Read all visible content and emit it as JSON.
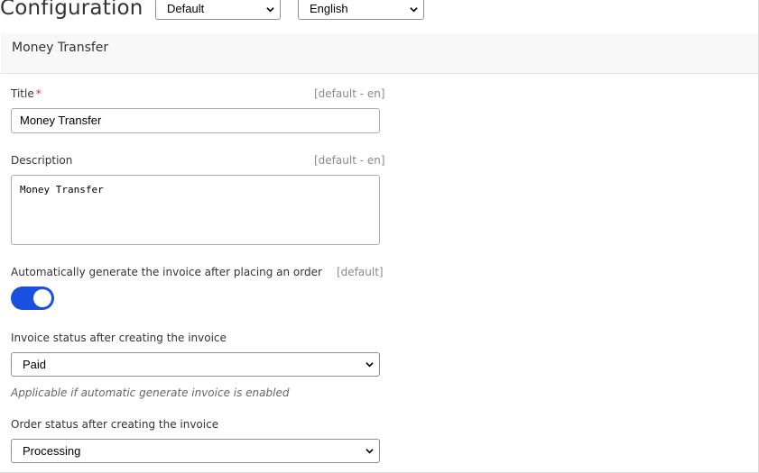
{
  "header": {
    "title": "Configuration",
    "scope_select": {
      "value": "Default"
    },
    "language_select": {
      "value": "English"
    }
  },
  "section": {
    "title": "Money Transfer"
  },
  "fields": {
    "title": {
      "label": "Title",
      "required_mark": "*",
      "scope": "[default - en]",
      "value": "Money Transfer"
    },
    "description": {
      "label": "Description",
      "scope": "[default - en]",
      "value": "Money Transfer"
    },
    "auto_invoice": {
      "label": "Automatically generate the invoice after placing an order",
      "scope": "[default]",
      "enabled": true
    },
    "invoice_status": {
      "label": "Invoice status after creating the invoice",
      "value": "Paid",
      "hint": "Applicable if automatic generate invoice is enabled"
    },
    "order_status": {
      "label": "Order status after creating the invoice",
      "value": "Processing"
    }
  },
  "colors": {
    "toggle_on": "#1a4fe0",
    "required": "#e02b27"
  },
  "icons": {
    "select_caret": "chevron-down-icon"
  }
}
